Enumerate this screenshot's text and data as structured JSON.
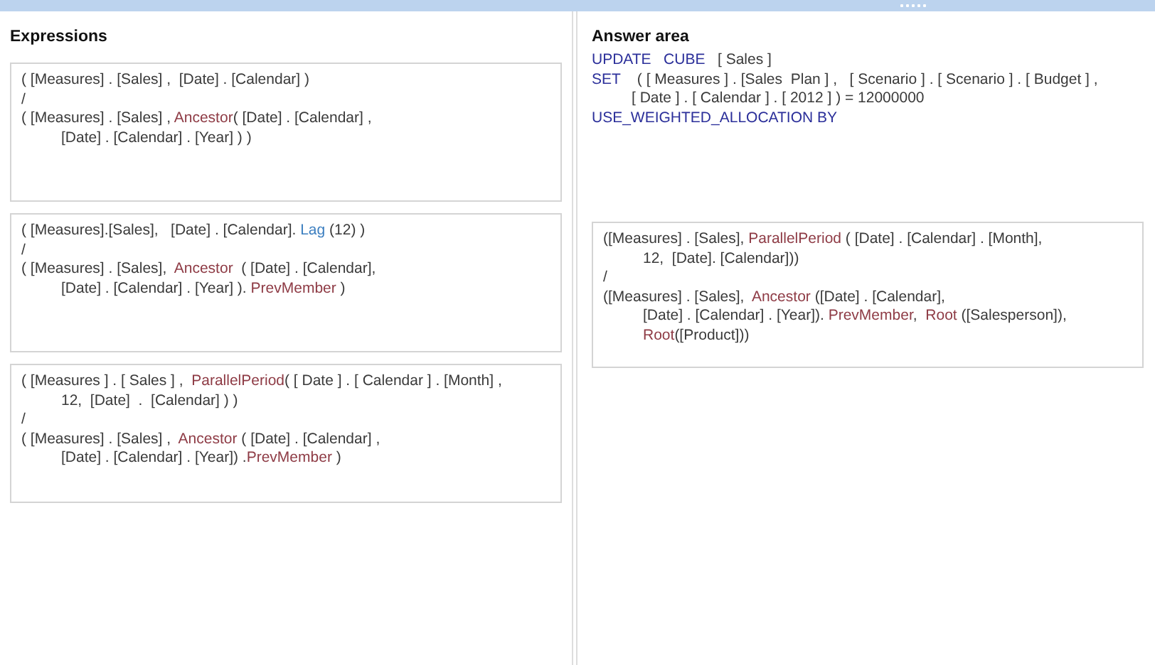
{
  "expressions": {
    "title": "Expressions",
    "items": [
      {
        "lines": [
          {
            "indented": false,
            "tokens": [
              {
                "kind": "plain",
                "text": "( [Measures] . [Sales] ,  [Date] . [Calendar] )"
              }
            ]
          },
          {
            "indented": false,
            "tokens": [
              {
                "kind": "plain",
                "text": "/"
              }
            ]
          },
          {
            "indented": false,
            "tokens": [
              {
                "kind": "plain",
                "text": "( [Measures] . [Sales] , "
              },
              {
                "kind": "function",
                "text": "Ancestor"
              },
              {
                "kind": "plain",
                "text": "( [Date] . [Calendar] ,"
              }
            ]
          },
          {
            "indented": true,
            "tokens": [
              {
                "kind": "plain",
                "text": "[Date] . [Calendar] . [Year] ) )"
              }
            ]
          }
        ]
      },
      {
        "lines": [
          {
            "indented": false,
            "tokens": [
              {
                "kind": "plain",
                "text": "( [Measures].[Sales],   [Date] . [Calendar]. "
              },
              {
                "kind": "method",
                "text": "Lag"
              },
              {
                "kind": "plain",
                "text": " (12) )"
              }
            ]
          },
          {
            "indented": false,
            "tokens": [
              {
                "kind": "plain",
                "text": "/"
              }
            ]
          },
          {
            "indented": false,
            "tokens": [
              {
                "kind": "plain",
                "text": "( [Measures] . [Sales],  "
              },
              {
                "kind": "function",
                "text": "Ancestor"
              },
              {
                "kind": "plain",
                "text": "  ( [Date] . [Calendar],"
              }
            ]
          },
          {
            "indented": true,
            "tokens": [
              {
                "kind": "plain",
                "text": "[Date] . [Calendar] . [Year] ). "
              },
              {
                "kind": "function",
                "text": "PrevMember"
              },
              {
                "kind": "plain",
                "text": " )"
              }
            ]
          }
        ]
      },
      {
        "lines": [
          {
            "indented": false,
            "tokens": [
              {
                "kind": "plain",
                "text": "( [Measures ] . [ Sales ] ,  "
              },
              {
                "kind": "function",
                "text": "ParallelPeriod"
              },
              {
                "kind": "plain",
                "text": "( [ Date ] . [ Calendar ] . [Month] ,"
              }
            ]
          },
          {
            "indented": true,
            "tokens": [
              {
                "kind": "plain",
                "text": "12,  [Date]  .  [Calendar] ) )"
              }
            ]
          },
          {
            "indented": false,
            "tokens": [
              {
                "kind": "plain",
                "text": "/"
              }
            ]
          },
          {
            "indented": false,
            "tokens": [
              {
                "kind": "plain",
                "text": "( [Measures] . [Sales] ,  "
              },
              {
                "kind": "function",
                "text": "Ancestor"
              },
              {
                "kind": "plain",
                "text": " ( [Date] . [Calendar] ,"
              }
            ]
          },
          {
            "indented": true,
            "tokens": [
              {
                "kind": "plain",
                "text": "[Date] . [Calendar] . [Year]) ."
              },
              {
                "kind": "function",
                "text": "PrevMember"
              },
              {
                "kind": "plain",
                "text": " )"
              }
            ]
          }
        ]
      }
    ]
  },
  "answer_area": {
    "title": "Answer area",
    "statement": [
      {
        "indented": false,
        "tokens": [
          {
            "kind": "keyword",
            "text": "UPDATE   CUBE"
          },
          {
            "kind": "plain",
            "text": "   [ Sales ]"
          }
        ]
      },
      {
        "indented": false,
        "tokens": [
          {
            "kind": "keyword",
            "text": "SET"
          },
          {
            "kind": "plain",
            "text": "    ( [ Measures ] . [Sales  Plan ] ,   [ Scenario ] . [ Scenario ] . [ Budget ] ,"
          }
        ]
      },
      {
        "indented": true,
        "tokens": [
          {
            "kind": "plain",
            "text": "[ Date ] . [ Calendar ] . [ 2012 ] ) = 12000000"
          }
        ]
      },
      {
        "indented": false,
        "tokens": [
          {
            "kind": "keyword",
            "text": "USE_WEIGHTED_ALLOCATION BY"
          }
        ]
      }
    ],
    "dropped": {
      "lines": [
        {
          "indented": false,
          "tokens": [
            {
              "kind": "plain",
              "text": "([Measures] . [Sales], "
            },
            {
              "kind": "function",
              "text": "ParallelPeriod"
            },
            {
              "kind": "plain",
              "text": " ( [Date] . [Calendar] . [Month],"
            }
          ]
        },
        {
          "indented": true,
          "tokens": [
            {
              "kind": "plain",
              "text": "12,  [Date]. [Calendar]))"
            }
          ]
        },
        {
          "indented": false,
          "tokens": [
            {
              "kind": "plain",
              "text": "/"
            }
          ]
        },
        {
          "indented": false,
          "tokens": [
            {
              "kind": "plain",
              "text": "([Measures] . [Sales],  "
            },
            {
              "kind": "function",
              "text": "Ancestor"
            },
            {
              "kind": "plain",
              "text": " ([Date] . [Calendar],"
            }
          ]
        },
        {
          "indented": true,
          "tokens": [
            {
              "kind": "plain",
              "text": "[Date] . [Calendar] . [Year]). "
            },
            {
              "kind": "function",
              "text": "PrevMember"
            },
            {
              "kind": "plain",
              "text": ",  "
            },
            {
              "kind": "function",
              "text": "Root"
            },
            {
              "kind": "plain",
              "text": " ([Salesperson]),"
            }
          ]
        },
        {
          "indented": true,
          "tokens": [
            {
              "kind": "function",
              "text": "Root"
            },
            {
              "kind": "plain",
              "text": "([Product]))"
            }
          ]
        }
      ]
    }
  }
}
